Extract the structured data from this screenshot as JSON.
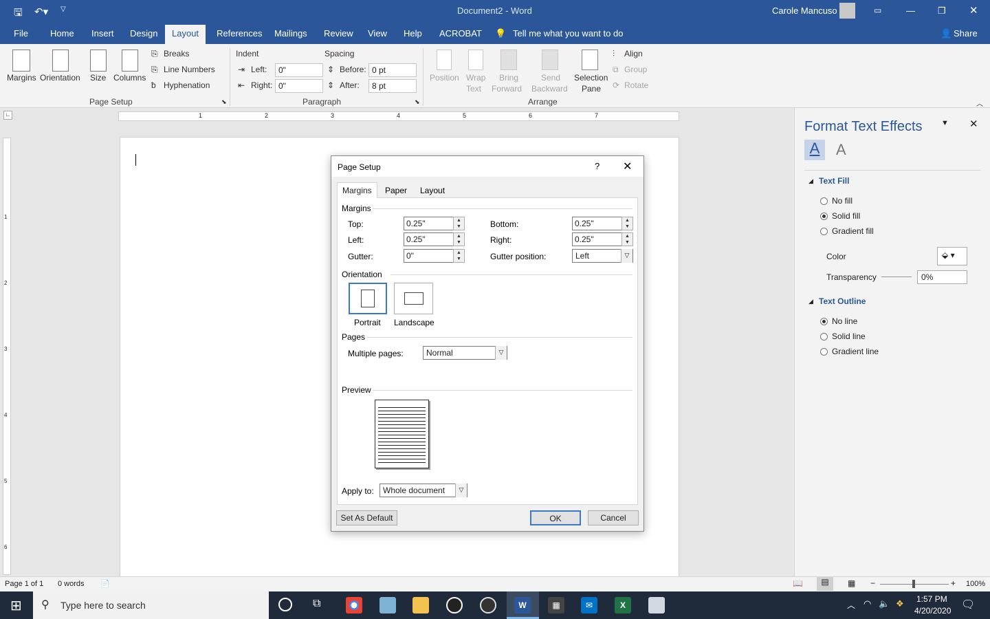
{
  "titlebar": {
    "doc_title": "Document2 - Word",
    "user": "Carole Mancuso"
  },
  "tabs": [
    "File",
    "Home",
    "Insert",
    "Design",
    "Layout",
    "References",
    "Mailings",
    "Review",
    "View",
    "Help",
    "ACROBAT"
  ],
  "tellme": "Tell me what you want to do",
  "share": "Share",
  "ribbon": {
    "margins": "Margins",
    "orientation": "Orientation",
    "size": "Size",
    "columns": "Columns",
    "breaks": "Breaks",
    "line_numbers": "Line Numbers",
    "hyphenation": "Hyphenation",
    "page_setup": "Page Setup",
    "indent": "Indent",
    "indent_left_label": "Left:",
    "indent_left": "0\"",
    "indent_right_label": "Right:",
    "indent_right": "0\"",
    "spacing": "Spacing",
    "before_label": "Before:",
    "before": "0 pt",
    "after_label": "After:",
    "after": "8 pt",
    "paragraph": "Paragraph",
    "position": "Position",
    "wrap": "Wrap",
    "text": "Text",
    "bring": "Bring",
    "forward": "Forward",
    "send": "Send",
    "backward": "Backward",
    "selection": "Selection",
    "pane": "Pane",
    "align": "Align",
    "group": "Group",
    "rotate": "Rotate",
    "arrange": "Arrange"
  },
  "ruler_numbers": [
    "1",
    "2",
    "3",
    "4",
    "5",
    "6",
    "7"
  ],
  "vruler_numbers": [
    "1",
    "2",
    "3",
    "4",
    "5",
    "6"
  ],
  "dialog": {
    "title": "Page Setup",
    "help": "?",
    "tabs": [
      "Margins",
      "Paper",
      "Layout"
    ],
    "margins_section": "Margins",
    "top_label": "Top:",
    "top": "0.25\"",
    "left_label": "Left:",
    "left": "0.25\"",
    "gutter_label": "Gutter:",
    "gutter": "0\"",
    "bottom_label": "Bottom:",
    "bottom": "0.25\"",
    "right_label": "Right:",
    "right": "0.25\"",
    "gutter_pos_label": "Gutter position:",
    "gutter_pos": "Left",
    "orientation_section": "Orientation",
    "portrait": "Portrait",
    "landscape": "Landscape",
    "pages_section": "Pages",
    "multiple_pages_label": "Multiple pages:",
    "multiple_pages": "Normal",
    "preview_section": "Preview",
    "apply_to_label": "Apply to:",
    "apply_to": "Whole document",
    "set_default": "Set As Default",
    "ok": "OK",
    "cancel": "Cancel"
  },
  "pane": {
    "title": "Format Text Effects",
    "text_fill": "Text Fill",
    "no_fill": "No fill",
    "solid_fill": "Solid fill",
    "gradient_fill": "Gradient fill",
    "color": "Color",
    "transparency": "Transparency",
    "transparency_value": "0%",
    "text_outline": "Text Outline",
    "no_line": "No line",
    "solid_line": "Solid line",
    "gradient_line": "Gradient line"
  },
  "status": {
    "page": "Page 1 of 1",
    "words": "0 words",
    "zoom": "100%"
  },
  "taskbar": {
    "search": "Type here to search",
    "time": "1:57 PM",
    "date": "4/20/2020"
  }
}
